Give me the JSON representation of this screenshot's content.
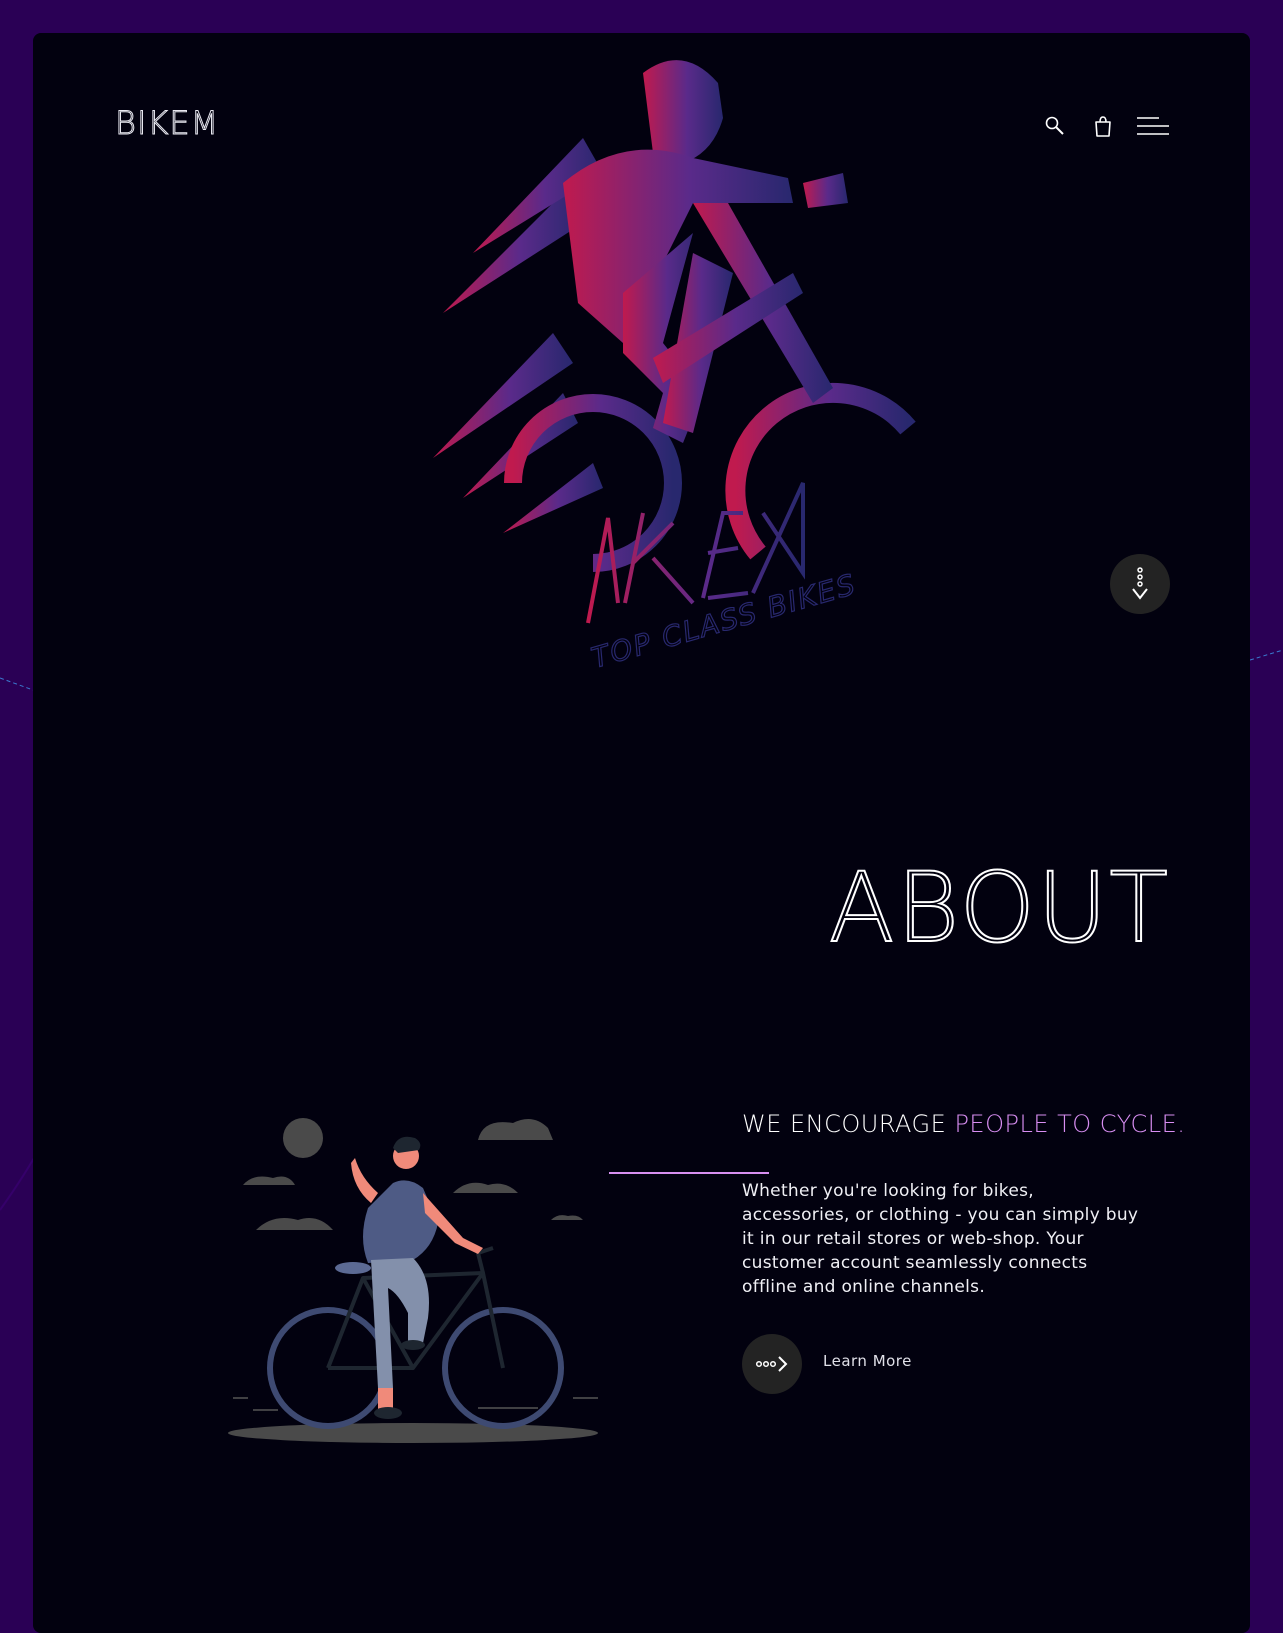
{
  "brand": {
    "name": "BIKEM"
  },
  "nav": {
    "icons": [
      "search-icon",
      "bag-icon",
      "menu-icon"
    ]
  },
  "hero": {
    "logo_title": "BIKEM",
    "logo_tagline": "TOP CLASS BIKES",
    "scroll_icon": "scroll-down-icon"
  },
  "about": {
    "title": "ABOUT",
    "headline_part1": "WE ENCOURAGE ",
    "headline_part2": "PEOPLE TO CYCLE.",
    "body": "Whether you're looking for bikes, accessories, or clothing - you can simply buy it in our retail stores or web-shop. Your customer account seamlessly connects offline and online channels.",
    "learn_more_label": "Learn More",
    "learn_more_icon": "dots-arrow-right-icon"
  },
  "colors": {
    "page_bg": "#2a0055",
    "card_bg": "#02010f",
    "accent": "#d88ef2",
    "gradient_start": "#c01a4e",
    "gradient_end": "#28286e",
    "button_bg": "#232323"
  }
}
